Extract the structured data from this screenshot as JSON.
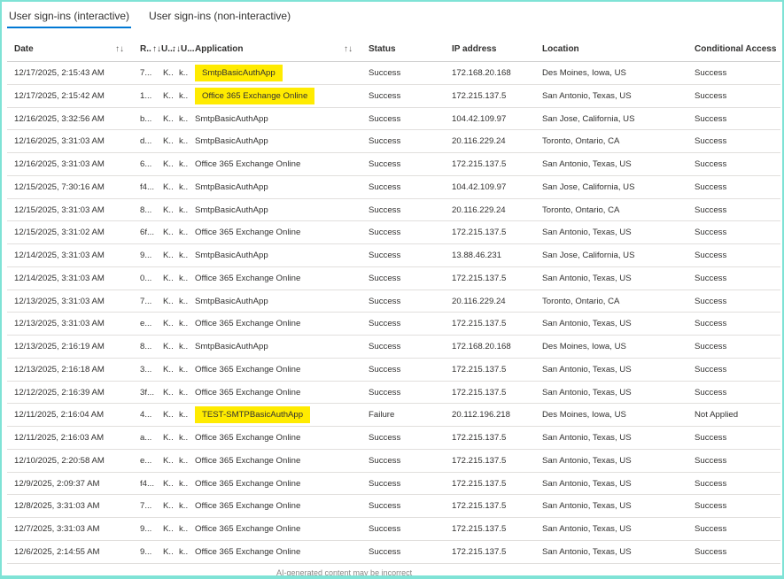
{
  "tabs": [
    "User sign-ins (interactive)",
    "User sign-ins (non-interactive)"
  ],
  "headers": {
    "date": "Date",
    "req": "R..",
    "u1": "↑↓U...",
    "u2": "↑↓U...",
    "app": "Application",
    "status": "Status",
    "ip": "IP address",
    "location": "Location",
    "ca": "Conditional Access"
  },
  "sort_glyph": "↑↓",
  "rows": [
    {
      "date": "12/17/2025, 2:15:43 AM",
      "req": "7...",
      "u1": "K..",
      "u2": "k..",
      "app": "SmtpBasicAuthApp",
      "status": "Success",
      "ip": "172.168.20.168",
      "location": "Des Moines, Iowa, US",
      "ca": "Success",
      "highlight": true
    },
    {
      "date": "12/17/2025, 2:15:42 AM",
      "req": "1...",
      "u1": "K..",
      "u2": "k..",
      "app": "Office 365 Exchange Online",
      "status": "Success",
      "ip": "172.215.137.5",
      "location": "San Antonio, Texas, US",
      "ca": "Success",
      "highlight": true
    },
    {
      "date": "12/16/2025, 3:32:56 AM",
      "req": "b...",
      "u1": "K..",
      "u2": "k..",
      "app": "SmtpBasicAuthApp",
      "status": "Success",
      "ip": "104.42.109.97",
      "location": "San Jose, California, US",
      "ca": "Success",
      "highlight": false
    },
    {
      "date": "12/16/2025, 3:31:03 AM",
      "req": "d...",
      "u1": "K..",
      "u2": "k..",
      "app": "SmtpBasicAuthApp",
      "status": "Success",
      "ip": "20.116.229.24",
      "location": "Toronto, Ontario, CA",
      "ca": "Success",
      "highlight": false
    },
    {
      "date": "12/16/2025, 3:31:03 AM",
      "req": "6...",
      "u1": "K..",
      "u2": "k..",
      "app": "Office 365 Exchange Online",
      "status": "Success",
      "ip": "172.215.137.5",
      "location": "San Antonio, Texas, US",
      "ca": "Success",
      "highlight": false
    },
    {
      "date": "12/15/2025, 7:30:16 AM",
      "req": "f4...",
      "u1": "K..",
      "u2": "k..",
      "app": "SmtpBasicAuthApp",
      "status": "Success",
      "ip": "104.42.109.97",
      "location": "San Jose, California, US",
      "ca": "Success",
      "highlight": false
    },
    {
      "date": "12/15/2025, 3:31:03 AM",
      "req": "8...",
      "u1": "K..",
      "u2": "k..",
      "app": "SmtpBasicAuthApp",
      "status": "Success",
      "ip": "20.116.229.24",
      "location": "Toronto, Ontario, CA",
      "ca": "Success",
      "highlight": false
    },
    {
      "date": "12/15/2025, 3:31:02 AM",
      "req": "6f...",
      "u1": "K..",
      "u2": "k..",
      "app": "Office 365 Exchange Online",
      "status": "Success",
      "ip": "172.215.137.5",
      "location": "San Antonio, Texas, US",
      "ca": "Success",
      "highlight": false
    },
    {
      "date": "12/14/2025, 3:31:03 AM",
      "req": "9...",
      "u1": "K..",
      "u2": "k..",
      "app": "SmtpBasicAuthApp",
      "status": "Success",
      "ip": "13.88.46.231",
      "location": "San Jose, California, US",
      "ca": "Success",
      "highlight": false
    },
    {
      "date": "12/14/2025, 3:31:03 AM",
      "req": "0...",
      "u1": "K..",
      "u2": "k..",
      "app": "Office 365 Exchange Online",
      "status": "Success",
      "ip": "172.215.137.5",
      "location": "San Antonio, Texas, US",
      "ca": "Success",
      "highlight": false
    },
    {
      "date": "12/13/2025, 3:31:03 AM",
      "req": "7...",
      "u1": "K..",
      "u2": "k..",
      "app": "SmtpBasicAuthApp",
      "status": "Success",
      "ip": "20.116.229.24",
      "location": "Toronto, Ontario, CA",
      "ca": "Success",
      "highlight": false
    },
    {
      "date": "12/13/2025, 3:31:03 AM",
      "req": "e...",
      "u1": "K..",
      "u2": "k..",
      "app": "Office 365 Exchange Online",
      "status": "Success",
      "ip": "172.215.137.5",
      "location": "San Antonio, Texas, US",
      "ca": "Success",
      "highlight": false
    },
    {
      "date": "12/13/2025, 2:16:19 AM",
      "req": "8...",
      "u1": "K..",
      "u2": "k..",
      "app": "SmtpBasicAuthApp",
      "status": "Success",
      "ip": "172.168.20.168",
      "location": "Des Moines, Iowa, US",
      "ca": "Success",
      "highlight": false
    },
    {
      "date": "12/13/2025, 2:16:18 AM",
      "req": "3...",
      "u1": "K..",
      "u2": "k..",
      "app": "Office 365 Exchange Online",
      "status": "Success",
      "ip": "172.215.137.5",
      "location": "San Antonio, Texas, US",
      "ca": "Success",
      "highlight": false
    },
    {
      "date": "12/12/2025, 2:16:39 AM",
      "req": "3f...",
      "u1": "K..",
      "u2": "k..",
      "app": "Office 365 Exchange Online",
      "status": "Success",
      "ip": "172.215.137.5",
      "location": "San Antonio, Texas, US",
      "ca": "Success",
      "highlight": false
    },
    {
      "date": "12/11/2025, 2:16:04 AM",
      "req": "4...",
      "u1": "K..",
      "u2": "k..",
      "app": "TEST-SMTPBasicAuthApp",
      "status": "Failure",
      "ip": "20.112.196.218",
      "location": "Des Moines, Iowa, US",
      "ca": "Not Applied",
      "highlight": true
    },
    {
      "date": "12/11/2025, 2:16:03 AM",
      "req": "a...",
      "u1": "K..",
      "u2": "k..",
      "app": "Office 365 Exchange Online",
      "status": "Success",
      "ip": "172.215.137.5",
      "location": "San Antonio, Texas, US",
      "ca": "Success",
      "highlight": false
    },
    {
      "date": "12/10/2025, 2:20:58 AM",
      "req": "e...",
      "u1": "K..",
      "u2": "k..",
      "app": "Office 365 Exchange Online",
      "status": "Success",
      "ip": "172.215.137.5",
      "location": "San Antonio, Texas, US",
      "ca": "Success",
      "highlight": false
    },
    {
      "date": "12/9/2025, 2:09:37 AM",
      "req": "f4...",
      "u1": "K..",
      "u2": "k..",
      "app": "Office 365 Exchange Online",
      "status": "Success",
      "ip": "172.215.137.5",
      "location": "San Antonio, Texas, US",
      "ca": "Success",
      "highlight": false
    },
    {
      "date": "12/8/2025, 3:31:03 AM",
      "req": "7...",
      "u1": "K..",
      "u2": "k..",
      "app": "Office 365 Exchange Online",
      "status": "Success",
      "ip": "172.215.137.5",
      "location": "San Antonio, Texas, US",
      "ca": "Success",
      "highlight": false
    },
    {
      "date": "12/7/2025, 3:31:03 AM",
      "req": "9...",
      "u1": "K..",
      "u2": "k..",
      "app": "Office 365 Exchange Online",
      "status": "Success",
      "ip": "172.215.137.5",
      "location": "San Antonio, Texas, US",
      "ca": "Success",
      "highlight": false
    },
    {
      "date": "12/6/2025, 2:14:55 AM",
      "req": "9...",
      "u1": "K..",
      "u2": "k..",
      "app": "Office 365 Exchange Online",
      "status": "Success",
      "ip": "172.215.137.5",
      "location": "San Antonio, Texas, US",
      "ca": "Success",
      "highlight": false
    }
  ],
  "footer_note": "AI-generated content may be incorrect",
  "colors": {
    "highlight": "#ffeb00",
    "accent": "#0078d4",
    "frame": "#7fe3d6"
  }
}
